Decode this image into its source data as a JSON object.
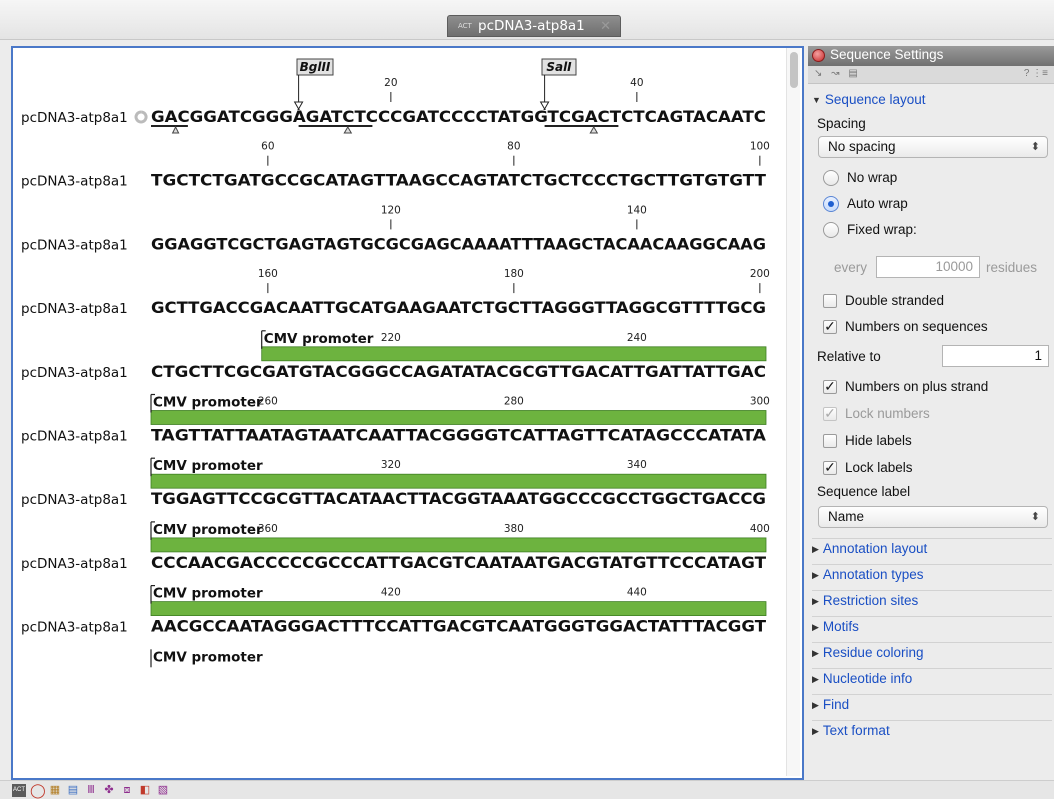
{
  "tab": {
    "icon": "ACT",
    "title": "pcDNA3-atp8a1",
    "close": "✕"
  },
  "sequence": {
    "name": "pcDNA3-atp8a1",
    "rows": [
      {
        "seq": "GACGGATCGGGAGATCTCCCGATCCCCTATGGTCGACTCTCAGTACAATC",
        "numbers": [
          {
            "value": "20",
            "pos": 20
          },
          {
            "value": "40",
            "pos": 40
          }
        ]
      },
      {
        "seq": "TGCTCTGATGCCGCATAGTTAAGCCAGTATCTGCTCCCTGCTTGTGTGTT",
        "numbers": [
          {
            "value": "60",
            "pos": 60
          },
          {
            "value": "80",
            "pos": 80
          },
          {
            "value": "100",
            "pos": 100
          }
        ]
      },
      {
        "seq": "GGAGGTCGCTGAGTAGTGCGCGAGCAAAATTTAAGCTACAACAAGGCAAG",
        "numbers": [
          {
            "value": "120",
            "pos": 120
          },
          {
            "value": "140",
            "pos": 140
          }
        ]
      },
      {
        "seq": "GCTTGACCGACAATTGCATGAAGAATCTGCTTAGGGTTAGGCGTTTTGCG",
        "numbers": [
          {
            "value": "160",
            "pos": 160
          },
          {
            "value": "180",
            "pos": 180
          },
          {
            "value": "200",
            "pos": 200
          }
        ]
      },
      {
        "seq": "CTGCTTCGCGATGTACGGGCCAGATATACGCGTTGACATTGATTATTGAC",
        "numbers": [
          {
            "value": "220",
            "pos": 220
          },
          {
            "value": "240",
            "pos": 240
          }
        ]
      },
      {
        "seq": "TAGTTATTAATAGTAATCAATTACGGGGTCATTAGTTCATAGCCCATATA",
        "numbers": [
          {
            "value": "260",
            "pos": 260
          },
          {
            "value": "280",
            "pos": 280
          },
          {
            "value": "300",
            "pos": 300
          }
        ]
      },
      {
        "seq": "TGGAGTTCCGCGTTACATAACTTACGGTAAATGGCCCGCCTGGCTGACCG",
        "numbers": [
          {
            "value": "320",
            "pos": 320
          },
          {
            "value": "340",
            "pos": 340
          }
        ]
      },
      {
        "seq": "CCCAACGACCCCCGCCCATTGACGTCAATAATGACGTATGTTCCCATAGT",
        "numbers": [
          {
            "value": "360",
            "pos": 360
          },
          {
            "value": "380",
            "pos": 380
          },
          {
            "value": "400",
            "pos": 400
          }
        ]
      },
      {
        "seq": "AACGCCAATAGGGACTTTCCATTGACGTCAATGGGTGGACTATTTACGGT",
        "numbers": [
          {
            "value": "420",
            "pos": 420
          },
          {
            "value": "440",
            "pos": 440
          }
        ]
      }
    ],
    "restriction_sites": [
      {
        "name": "BglII"
      },
      {
        "name": "SalI"
      }
    ],
    "annotation_label": "CMV promoter",
    "annotation_color": "#6db33f"
  },
  "settings": {
    "title": "Sequence Settings",
    "help": "?",
    "sequence_layout": "Sequence layout",
    "spacing_label": "Spacing",
    "spacing_value": "No spacing",
    "wrap_options": [
      "No wrap",
      "Auto wrap",
      "Fixed wrap:"
    ],
    "every_label": "every",
    "every_value": "10000",
    "residues_label": "residues",
    "double_stranded": "Double stranded",
    "numbers_on_sequences": "Numbers on sequences",
    "relative_to_label": "Relative to",
    "relative_to_value": "1",
    "numbers_on_plus_strand": "Numbers on plus strand",
    "lock_numbers": "Lock numbers",
    "hide_labels": "Hide labels",
    "lock_labels": "Lock labels",
    "sequence_label": "Sequence label",
    "sequence_label_value": "Name",
    "sections": [
      "Annotation layout",
      "Annotation types",
      "Restriction sites",
      "Motifs",
      "Residue coloring",
      "Nucleotide info",
      "Find",
      "Text format"
    ]
  },
  "colors": {
    "accent": "#1a4fc4",
    "editor_border": "#4a78c8"
  }
}
